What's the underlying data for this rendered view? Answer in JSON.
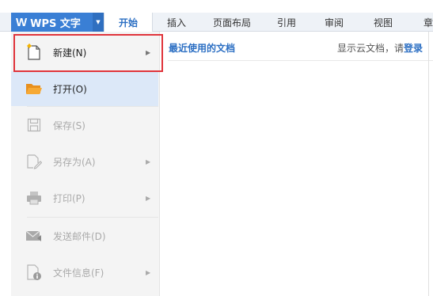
{
  "app": {
    "logo_glyph": "W",
    "title": "WPS 文字",
    "caret": "▼",
    "brand_color": "#3a7fd5"
  },
  "tabs": [
    {
      "label": "开始",
      "active": true
    },
    {
      "label": "插入"
    },
    {
      "label": "页面布局"
    },
    {
      "label": "引用"
    },
    {
      "label": "审阅"
    },
    {
      "label": "视图"
    },
    {
      "label": "章"
    }
  ],
  "menu": {
    "items": [
      {
        "label": "新建(N)",
        "icon": "new-document-icon",
        "enabled": true,
        "has_submenu": true,
        "arrow": "▶"
      },
      {
        "label": "打开(O)",
        "icon": "open-folder-icon",
        "enabled": true,
        "hover": true
      },
      {
        "label": "保存(S)",
        "icon": "save-icon",
        "enabled": false
      },
      {
        "label": "另存为(A)",
        "icon": "save-as-icon",
        "enabled": false,
        "has_submenu": true,
        "arrow": "▶"
      },
      {
        "label": "打印(P)",
        "icon": "printer-icon",
        "enabled": false,
        "has_submenu": true,
        "arrow": "▶"
      },
      {
        "label": "发送邮件(D)",
        "icon": "send-mail-icon",
        "enabled": false
      },
      {
        "label": "文件信息(F)",
        "icon": "file-info-icon",
        "enabled": false,
        "has_submenu": true,
        "arrow": "▶"
      }
    ],
    "highlight_color": "#e0343b"
  },
  "content": {
    "recent_title": "最近使用的文档",
    "cloud_prefix": "显示云文档，请",
    "cloud_link": "登录"
  }
}
